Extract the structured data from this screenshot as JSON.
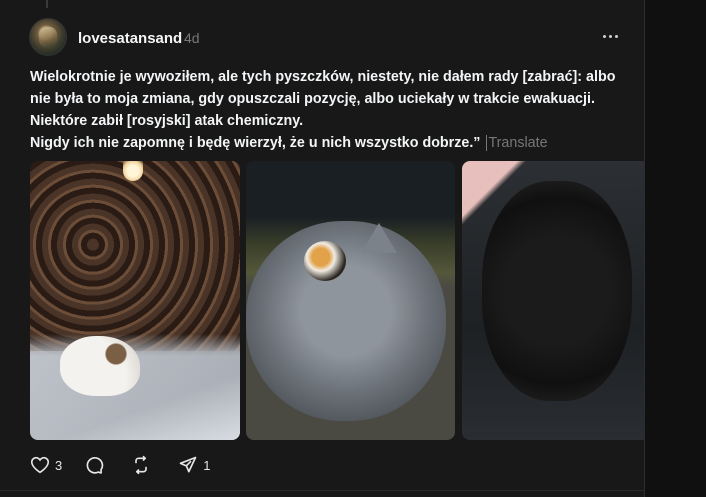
{
  "post": {
    "username": "lovesatansand",
    "time": "4d",
    "text_lines": [
      "Wielokrotnie je wywoziłem, ale tych pyszczków, niestety, nie dałem rady [zabrać]: albo",
      "nie była to moja zmiana, gdy opuszczali pozycję, albo uciekały w trakcie ewakuacji.",
      "Niektóre zabił [rosyjski] atak chemiczny.",
      "Nigdy ich nie zapomnę i będę wierzył, że u nich wszystko dobrze.”"
    ],
    "translate_label": "Translate",
    "images": [
      {
        "name": "post-image-1"
      },
      {
        "name": "post-image-2"
      },
      {
        "name": "post-image-3"
      }
    ]
  },
  "actions": {
    "like_count": "3",
    "comment_count": "",
    "repost_count": "",
    "share_count": "1"
  },
  "icons": {
    "more": "more-horizontal-icon",
    "like": "heart-icon",
    "comment": "comment-icon",
    "repost": "repost-icon",
    "share": "send-icon"
  },
  "colors": {
    "background": "#101010",
    "card": "#181818",
    "text_primary": "#f3f5f7",
    "text_secondary": "#777777"
  }
}
